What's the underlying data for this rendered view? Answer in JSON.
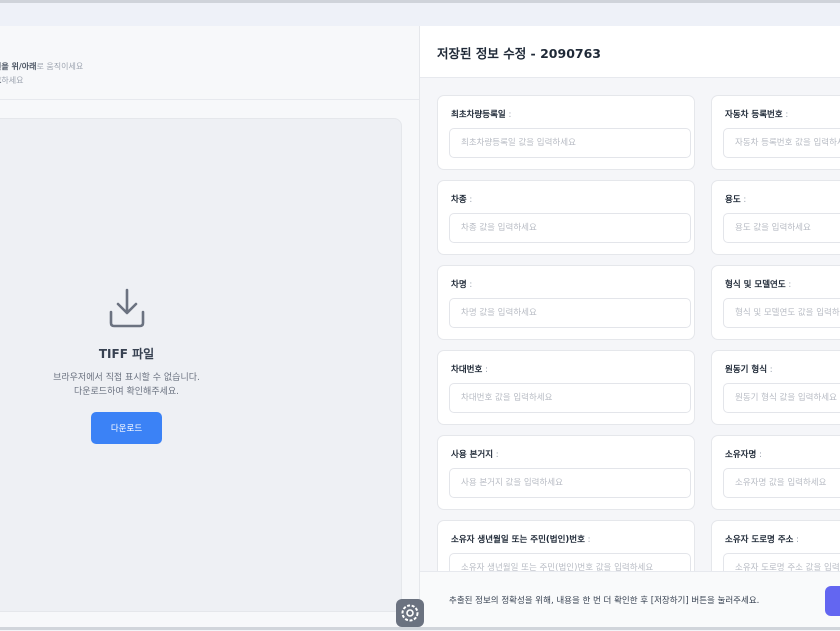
{
  "left_panel": {
    "hint_line1_bold": "월을 위/아래",
    "hint_line1_rest": "로 움직이세요",
    "hint_line2_bold": "그",
    "hint_line2_rest": "하세요",
    "viewer": {
      "icon": "download-icon",
      "title": "TIFF 파일",
      "desc_line1": "브라우저에서 직접 표시할 수 없습니다.",
      "desc_line2": "다운로드하여 확인해주세요.",
      "download_label": "다운로드"
    }
  },
  "right_panel": {
    "title": "저장된 정보 수정 - 2090763",
    "fields": [
      {
        "label": "최초차량등록일",
        "sep": " :",
        "placeholder": "최초차량등록일 값을 입력하세요"
      },
      {
        "label": "자동차 등록번호",
        "sep": " :",
        "placeholder": "자동차 등록번호 값을 입력하세요"
      },
      {
        "label": "차종",
        "sep": " :",
        "placeholder": "차종 값을 입력하세요"
      },
      {
        "label": "용도",
        "sep": " :",
        "placeholder": "용도 값을 입력하세요"
      },
      {
        "label": "차명",
        "sep": " :",
        "placeholder": "차명 값을 입력하세요"
      },
      {
        "label": "형식 및 모델연도",
        "sep": " :",
        "placeholder": "형식 및 모델연도 값을 입력하세요"
      },
      {
        "label": "차대번호",
        "sep": " :",
        "placeholder": "차대번호 값을 입력하세요"
      },
      {
        "label": "원동기 형식",
        "sep": " :",
        "placeholder": "원동기 형식 값을 입력하세요"
      },
      {
        "label": "사용 본거지",
        "sep": " :",
        "placeholder": "사용 본거지 값을 입력하세요"
      },
      {
        "label": "소유자명",
        "sep": " :",
        "placeholder": "소유자명 값을 입력하세요"
      },
      {
        "label": "소유자 생년월일 또는 주민(법인)번호",
        "sep": " :",
        "placeholder": "소유자 생년월일 또는 주민(법인)번호 값을 입력하세요"
      },
      {
        "label": "소유자 도로명 주소",
        "sep": " :",
        "placeholder": "소유자 도로명 주소 값을 입력하세요"
      }
    ],
    "footer_text": "추출된 정보의 정확성을 위해, 내용을 한 번 더 확인한 후 [저장하기] 버튼을 눌러주세요.",
    "save_color": "#6366f1"
  },
  "floating": {
    "icon": "gear-icon"
  },
  "colors": {
    "accent": "#3b82f6",
    "save": "#6366f1"
  }
}
